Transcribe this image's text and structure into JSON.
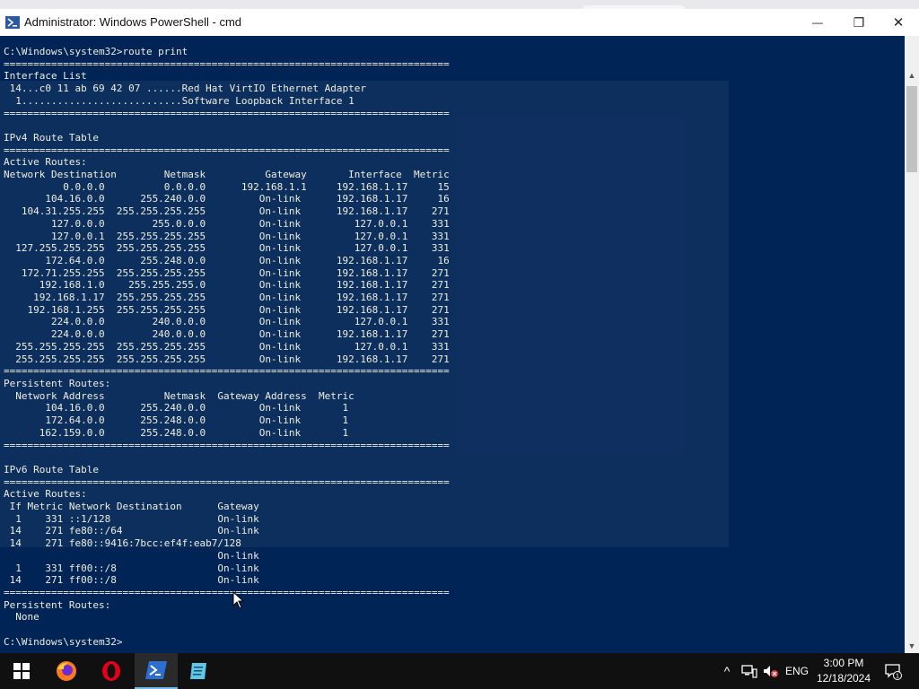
{
  "window": {
    "title": "Administrator: Windows PowerShell - cmd",
    "minimize_glyph": "—",
    "maximize_glyph": "❐",
    "close_glyph": "✕"
  },
  "console": {
    "lines": [
      "C:\\Windows\\system32>route print",
      "===========================================================================",
      "Interface List",
      " 14...c0 11 ab 69 42 07 ......Red Hat VirtIO Ethernet Adapter",
      "  1...........................Software Loopback Interface 1",
      "===========================================================================",
      "",
      "IPv4 Route Table",
      "===========================================================================",
      "Active Routes:",
      "Network Destination        Netmask          Gateway       Interface  Metric",
      "          0.0.0.0          0.0.0.0      192.168.1.1     192.168.1.17     15",
      "       104.16.0.0      255.240.0.0         On-link      192.168.1.17     16",
      "   104.31.255.255  255.255.255.255         On-link      192.168.1.17    271",
      "        127.0.0.0        255.0.0.0         On-link         127.0.0.1    331",
      "        127.0.0.1  255.255.255.255         On-link         127.0.0.1    331",
      "  127.255.255.255  255.255.255.255         On-link         127.0.0.1    331",
      "       172.64.0.0      255.248.0.0         On-link      192.168.1.17     16",
      "   172.71.255.255  255.255.255.255         On-link      192.168.1.17    271",
      "      192.168.1.0    255.255.255.0         On-link      192.168.1.17    271",
      "     192.168.1.17  255.255.255.255         On-link      192.168.1.17    271",
      "    192.168.1.255  255.255.255.255         On-link      192.168.1.17    271",
      "        224.0.0.0        240.0.0.0         On-link         127.0.0.1    331",
      "        224.0.0.0        240.0.0.0         On-link      192.168.1.17    271",
      "  255.255.255.255  255.255.255.255         On-link         127.0.0.1    331",
      "  255.255.255.255  255.255.255.255         On-link      192.168.1.17    271",
      "===========================================================================",
      "Persistent Routes:",
      "  Network Address          Netmask  Gateway Address  Metric",
      "       104.16.0.0      255.240.0.0         On-link       1",
      "       172.64.0.0      255.248.0.0         On-link       1",
      "      162.159.0.0      255.248.0.0         On-link       1",
      "===========================================================================",
      "",
      "IPv6 Route Table",
      "===========================================================================",
      "Active Routes:",
      " If Metric Network Destination      Gateway",
      "  1    331 ::1/128                  On-link",
      " 14    271 fe80::/64                On-link",
      " 14    271 fe80::9416:7bcc:ef4f:eab7/128",
      "                                    On-link",
      "  1    331 ff00::/8                 On-link",
      " 14    271 ff00::/8                 On-link",
      "===========================================================================",
      "Persistent Routes:",
      "  None",
      "",
      "C:\\Windows\\system32>"
    ]
  },
  "scrollbar": {
    "up_glyph": "▲",
    "down_glyph": "▼"
  },
  "taskbar": {
    "items": [
      {
        "icon": "windows-start-icon"
      },
      {
        "icon": "firefox-icon"
      },
      {
        "icon": "opera-icon"
      },
      {
        "icon": "powershell-icon"
      },
      {
        "icon": "notepad-icon"
      }
    ],
    "tray": {
      "chevron_glyph": "^",
      "language": "ENG",
      "notification_count": "1"
    },
    "clock": {
      "time": "3:00 PM",
      "date": "12/18/2024"
    }
  },
  "colors": {
    "console_bg": "#012456",
    "console_text": "#eeeedd",
    "taskbar_bg": "#101010",
    "accent": "#76b9ed"
  }
}
